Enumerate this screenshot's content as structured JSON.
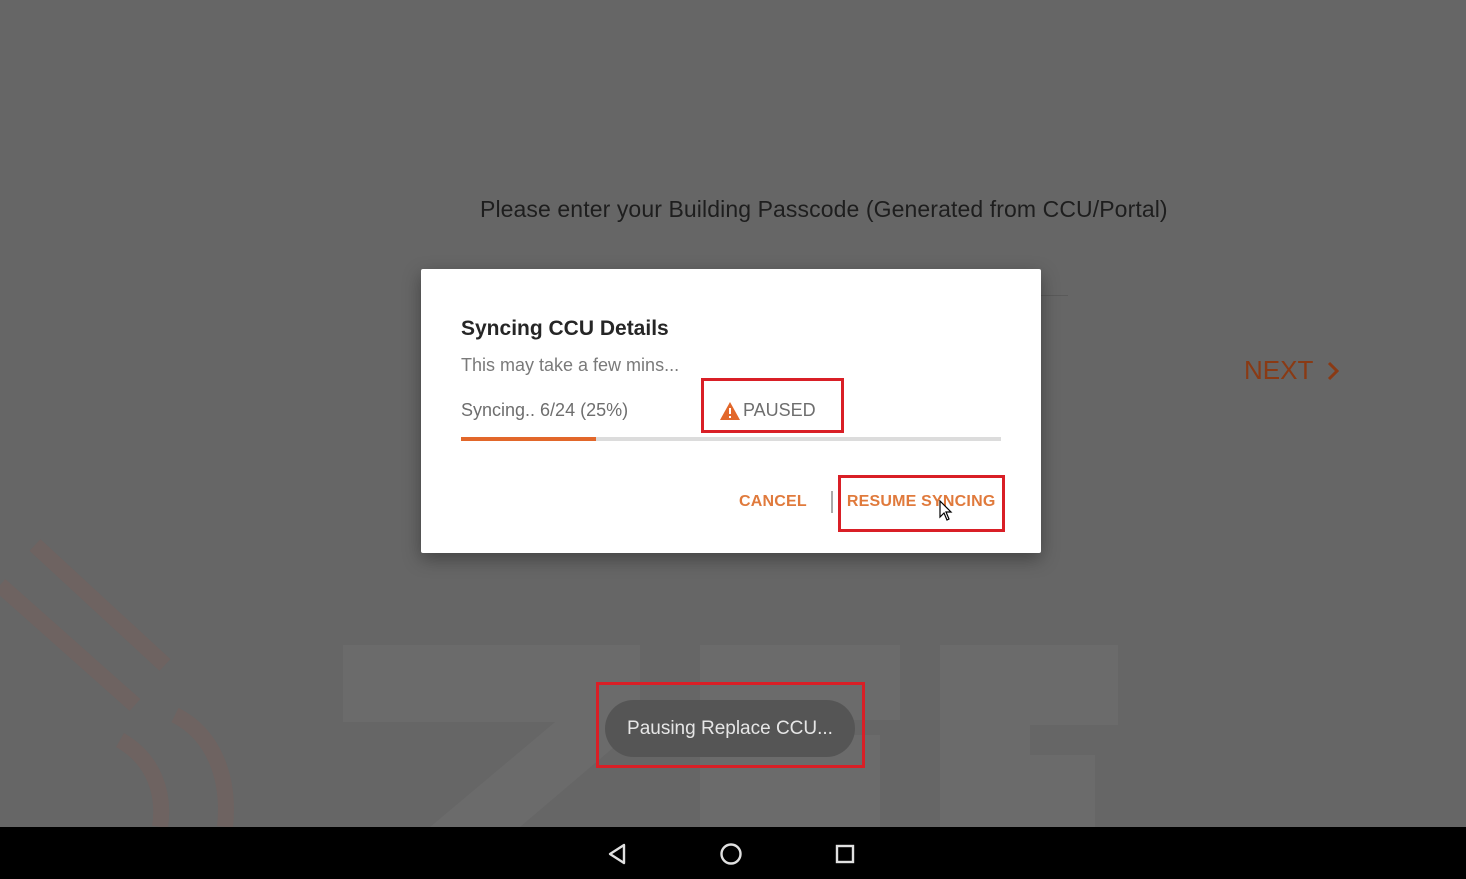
{
  "screen": {
    "prompt": "Please enter your Building Passcode (Generated from CCU/Portal)",
    "next_label": "NEXT",
    "watermark": "75F"
  },
  "dialog": {
    "title": "Syncing CCU Details",
    "subtitle": "This may take a few mins...",
    "status": "Syncing.. 6/24 (25%)",
    "paused_label": "PAUSED",
    "progress_fraction": 0.25,
    "cancel_label": "CANCEL",
    "resume_label": "RESUME SYNCING"
  },
  "toast": {
    "text": "Pausing Replace CCU..."
  },
  "icons": {
    "next": "chevron-right-icon",
    "warning": "warning-icon",
    "back": "back-icon",
    "home": "home-icon",
    "recents": "recents-icon"
  },
  "colors": {
    "accent": "#e2672a",
    "highlight": "#d91f26"
  }
}
